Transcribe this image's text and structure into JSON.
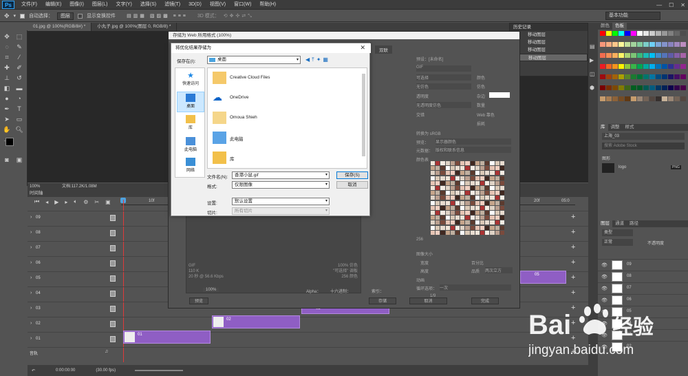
{
  "menubar": {
    "logo": "Ps",
    "items": [
      "文件(F)",
      "编辑(E)",
      "图像(I)",
      "图层(L)",
      "文字(Y)",
      "选择(S)",
      "滤镜(T)",
      "3D(D)",
      "视图(V)",
      "窗口(W)",
      "帮助(H)"
    ]
  },
  "options": {
    "auto_select": "自动选择：",
    "layer_select": "图层",
    "show_transform": "显示变换控件",
    "mode3d": "3D 模式：",
    "workspace": "基本功能"
  },
  "tabs": [
    {
      "label": "01.jpg @ 100%(RGB/8#) *",
      "active": true
    },
    {
      "label": "小丸子.jpg @ 100%(图层 0, RGB/8) *",
      "active": false
    }
  ],
  "status": {
    "zoom": "100%",
    "doc": "文档:117.2K/1.08M"
  },
  "timeline": {
    "title": "时间轴",
    "ruler": [
      "10f",
      "20f",
      "05:0"
    ],
    "tracks": [
      "09",
      "08",
      "07",
      "06",
      "05",
      "04",
      "03",
      "02",
      "01"
    ],
    "audio": "音轨",
    "time": "0:00:00:00",
    "fps": "(30.00 fps)",
    "clips": [
      {
        "label": "01"
      },
      {
        "label": "02"
      },
      {
        "label": "03"
      },
      {
        "label": "05"
      }
    ]
  },
  "history": {
    "title": "历史记录",
    "items": [
      "移动图层",
      "移动图层",
      "移动图层",
      "移动图层"
    ]
  },
  "swatches": {
    "tabs": [
      "颜色",
      "色板"
    ],
    "colors": [
      "#ff0000",
      "#ffff00",
      "#00ff00",
      "#00ffff",
      "#0000ff",
      "#ff00ff",
      "#ffffff",
      "#e6e6e6",
      "#cccccc",
      "#b3b3b3",
      "#999999",
      "#808080",
      "#666666",
      "#4d4d4d",
      "#f7977a",
      "#f9ad81",
      "#fdc68a",
      "#fff79a",
      "#c4df9b",
      "#a2d39c",
      "#82ca9d",
      "#7bcdc8",
      "#6ecff6",
      "#7ea7d8",
      "#8493ca",
      "#8882be",
      "#a187be",
      "#bc8dbf",
      "#f26c4f",
      "#f68e55",
      "#fbaf5c",
      "#fff467",
      "#acd372",
      "#7cc576",
      "#3bb878",
      "#1abbb4",
      "#00bff3",
      "#438cca",
      "#5574b9",
      "#605ca8",
      "#855fa8",
      "#a763a8",
      "#ed1c24",
      "#f26522",
      "#f7941d",
      "#fff200",
      "#8dc73f",
      "#39b54a",
      "#00a651",
      "#00a99d",
      "#00aeef",
      "#0072bc",
      "#0054a6",
      "#2e3192",
      "#662d91",
      "#92278f",
      "#9e0b0f",
      "#a0410d",
      "#a36209",
      "#aba000",
      "#598527",
      "#1a7b30",
      "#007236",
      "#00746b",
      "#0076a3",
      "#004b80",
      "#003471",
      "#1b1464",
      "#440e62",
      "#630460",
      "#790000",
      "#7b2e00",
      "#7d4900",
      "#827b00",
      "#406618",
      "#005e20",
      "#005826",
      "#005952",
      "#005b7f",
      "#003663",
      "#002157",
      "#0d004c",
      "#32004b",
      "#4b0049",
      "#c69c6d",
      "#a67c52",
      "#8c6239",
      "#754c24",
      "#603913",
      "#c69c6d",
      "#998675",
      "#736357",
      "#534741",
      "#362f2d",
      "#c7b299",
      "#998675",
      "#736357",
      "#534741"
    ]
  },
  "library": {
    "tabs": [
      "库",
      "调整",
      "样式"
    ],
    "lib_name": "上海_03",
    "search": "搜索 Adobe Stock",
    "group": "图形",
    "item": "logo",
    "badge": "PNG"
  },
  "layers": {
    "tabs": [
      "图层",
      "通道",
      "路径"
    ],
    "kind": "类型",
    "blend": "正常",
    "opacity": "不透明度",
    "rows": [
      "09",
      "08",
      "07",
      "06",
      "05",
      "04",
      "03",
      "02"
    ]
  },
  "sfw": {
    "title": "存储为 Web 所用格式 (100%)",
    "tab": "双联",
    "preset": "预设：[未命名]",
    "format": "GIF",
    "reduce": "可选择",
    "dither": "无仿色",
    "transp": "透明度",
    "dither2": "无透明度仿色",
    "interlace": "交错",
    "lossy": "损耗",
    "colors": "颜色",
    "dither_amt": "仿色",
    "matte": "杂边",
    "amount": "数量",
    "web": "Web 靠色",
    "convert": "转换为 sRGB",
    "preview": "预览：",
    "preview_val": "显示器颜色",
    "metadata": "元数据：",
    "metadata_val": "版权和联系信息",
    "ct_title": "颜色表",
    "ct_count": "256",
    "size_title": "图像大小",
    "w": "宽度",
    "h": "高度",
    "pct": "百分比",
    "quality": "品质",
    "quality_val": "两次立方",
    "anim": "动画",
    "loop": "循环选项：",
    "loop_val": "一次",
    "frames": "1/9",
    "info1": "GIF",
    "info2": "110 K",
    "info3": "20 秒 @ 56.6 Kbps",
    "info4": "100% 仿色",
    "info5": "\"可选择\" 调板",
    "info6": "256 颜色",
    "zoom": "100%",
    "alpha": "Alpha：",
    "hex": "十六进制：",
    "index": "索引：",
    "btn_preview": "预览",
    "btn_save": "存储",
    "btn_cancel": "取消",
    "btn_done": "完成",
    "colortable": [
      "#f1e5d9",
      "#d9c8b6",
      "#5b3a2e",
      "#c6a58b",
      "#f0cfc1",
      "#7a4a3c",
      "#dfd3c6",
      "#a33",
      "#e8dcd0",
      "#fff",
      "#c0b0a0",
      "#402820",
      "#e6c4b4",
      "#bba090",
      "#f5ece4"
    ]
  },
  "dlg": {
    "title": "将优化结果存储为",
    "savein": "保存在(I):",
    "location": "桌面",
    "side": [
      "快速访问",
      "桌面",
      "库",
      "此电脑",
      "网络"
    ],
    "files": [
      "Creative Cloud Files",
      "OneDrive",
      "Omoua Shieh",
      "此电脑",
      "库"
    ],
    "fname_label": "文件名(N):",
    "fname": "香港小鼠.gif",
    "format_label": "格式:",
    "format": "仅限图像",
    "settings_label": "设置:",
    "settings": "默认设置",
    "slices_label": "切片:",
    "slices": "所有切片",
    "save": "保存(S)",
    "cancel": "取消"
  },
  "watermark": {
    "brand_left": "Bai",
    "brand_right": "经验",
    "url": "jingyan.baidu.com"
  }
}
